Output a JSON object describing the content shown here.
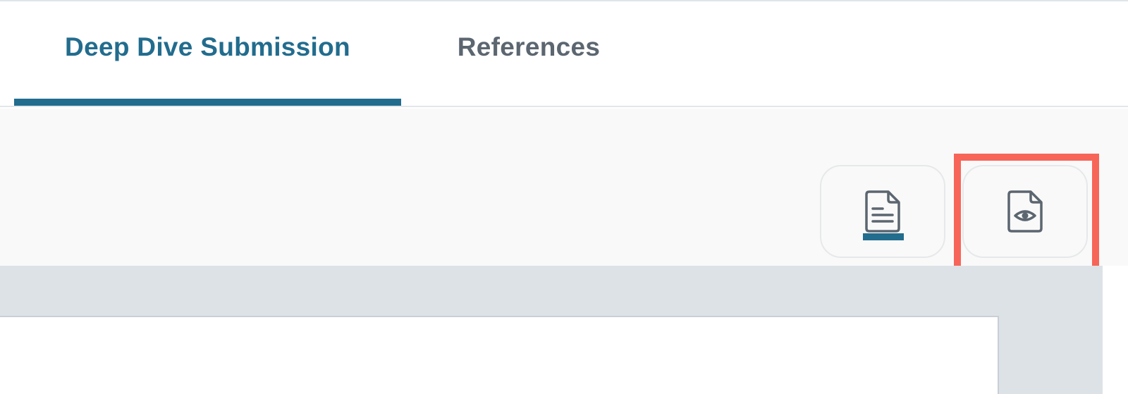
{
  "tabs": [
    {
      "label": "Deep Dive Submission",
      "active": true
    },
    {
      "label": "References",
      "active": false
    }
  ],
  "toolbar": {
    "document_view": {
      "icon": "document-icon",
      "active": true
    },
    "preview_view": {
      "icon": "document-preview-icon",
      "active": false,
      "highlighted": true
    }
  },
  "colors": {
    "accent": "#226c8e",
    "inactive_tab_text": "#5c6670",
    "highlight": "#f76558",
    "toolbar_bg": "#f9f9f9",
    "preview_bg": "#dde2e6"
  }
}
